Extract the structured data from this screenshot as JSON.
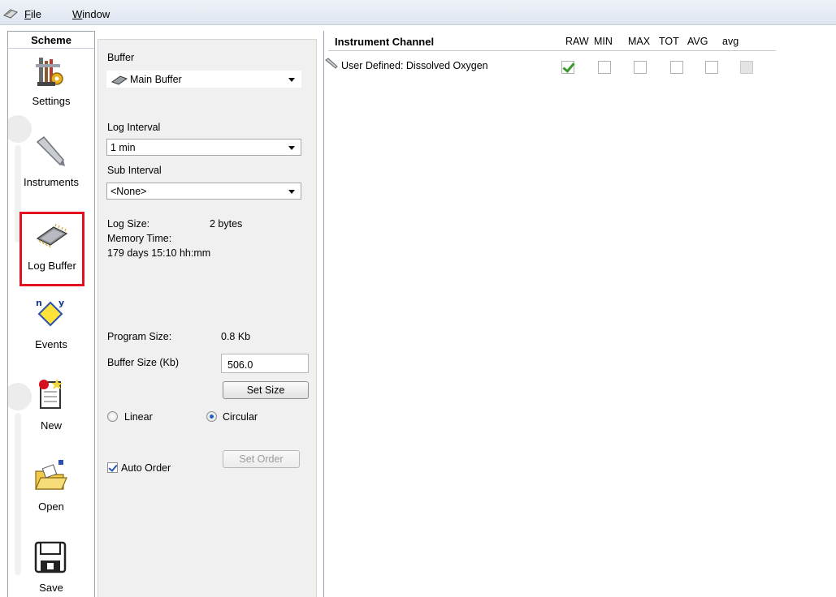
{
  "menu": {
    "file": "File",
    "file_accel": "F",
    "file_rest": "ile",
    "window": "Window",
    "window_accel": "W",
    "window_rest": "indow"
  },
  "scheme": {
    "title": "Scheme",
    "tools": [
      {
        "label": "Settings",
        "icon": "settings-tools-icon"
      },
      {
        "label": "Instruments",
        "icon": "pencil-probe-icon"
      },
      {
        "label": "Log Buffer",
        "icon": "memory-chip-icon",
        "selected": true
      },
      {
        "label": "Events",
        "icon": "events-diamond-icon"
      },
      {
        "label": "New",
        "icon": "new-document-icon"
      },
      {
        "label": "Open",
        "icon": "open-folder-icon"
      },
      {
        "label": "Save",
        "icon": "floppy-disk-icon"
      }
    ]
  },
  "buffer_panel": {
    "buffer_label": "Buffer",
    "buffer_value": "Main Buffer",
    "log_interval_label": "Log Interval",
    "log_interval_value": "1 min",
    "sub_interval_label": "Sub Interval",
    "sub_interval_value": "<None>",
    "log_size_label": "Log Size:",
    "log_size_value": "2 bytes",
    "memory_time_label": "Memory Time:",
    "memory_time_value": "179 days 15:10 hh:mm",
    "program_size_label": "Program Size:",
    "program_size_value": "0.8 Kb",
    "buffer_size_label": "Buffer Size (Kb)",
    "buffer_size_value": "506.0",
    "set_size_label": "Set Size",
    "linear_label": "Linear",
    "circular_label": "Circular",
    "mode_selected": "Circular",
    "auto_order_label": "Auto Order",
    "auto_order_checked": true,
    "set_order_label": "Set Order"
  },
  "channel_table": {
    "header": "Instrument Channel",
    "columns": [
      "RAW",
      "MIN",
      "MAX",
      "TOT",
      "AVG",
      "avg"
    ],
    "rows": [
      {
        "label": "User Defined: Dissolved Oxygen",
        "raw": true,
        "min": false,
        "max": false,
        "tot": false,
        "avg": false,
        "avg_lower": "disabled"
      }
    ]
  },
  "colors": {
    "selection_outline": "#e3101e",
    "check_green": "#3c9a2c"
  }
}
